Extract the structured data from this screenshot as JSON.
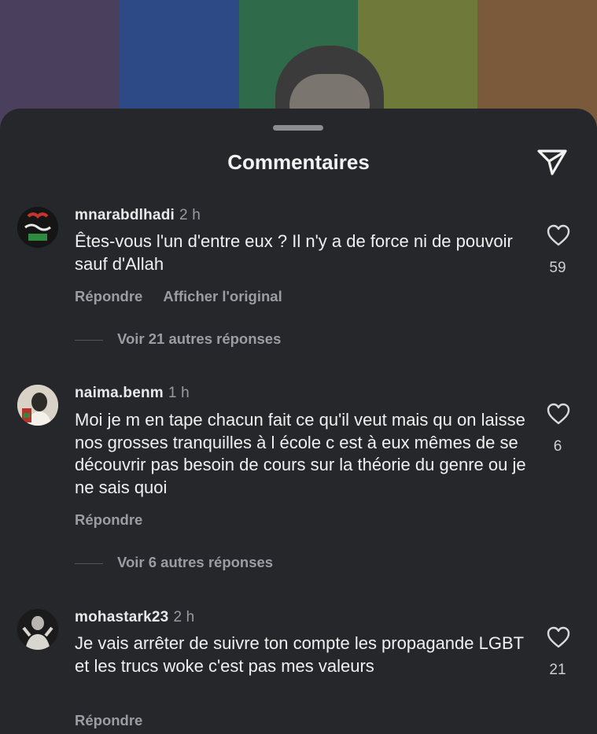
{
  "header": {
    "title": "Commentaires"
  },
  "icons": {
    "send": "send-icon",
    "like": "heart-outline-icon"
  },
  "comments": [
    {
      "username": "mnarabdlhadi",
      "time": "2 h",
      "text": "Êtes-vous l'un d'entre eux ? Il n'y a de force ni de pouvoir sauf d'Allah",
      "likes": "59",
      "reply_label": "Répondre",
      "translate_label": "Afficher l'original",
      "more_replies": "Voir 21 autres réponses"
    },
    {
      "username": "naima.benm",
      "time": "1 h",
      "text": "Moi je m en tape chacun fait ce qu'il veut mais qu on laisse nos grosses tranquilles à l école c est à eux mêmes de se découvrir pas besoin de cours sur la théorie du genre ou je ne sais quoi",
      "likes": "6",
      "reply_label": "Répondre",
      "more_replies": "Voir 6 autres réponses"
    },
    {
      "username": "mohastark23",
      "time": "2 h",
      "text": "Je vais arrêter de suivre ton compte les propagande LGBT et les trucs woke c'est pas mes valeurs",
      "likes": "21",
      "reply_label": "Répondre"
    }
  ],
  "colors": {
    "sheet": "#26272b",
    "text": "#f0f0f0",
    "muted": "#9c9da2"
  }
}
